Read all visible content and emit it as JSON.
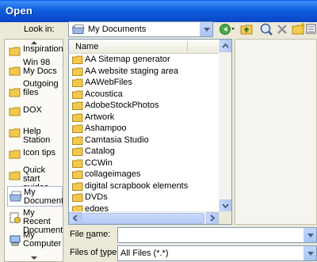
{
  "window": {
    "title": "Open"
  },
  "lookin": {
    "label": "Look in:",
    "value": "My Documents"
  },
  "places": [
    {
      "label": "Inspirations",
      "icon": "folder-icon"
    },
    {
      "label": "Win 98 My Docs",
      "icon": "folder-icon"
    },
    {
      "label": "Outgoing files",
      "icon": "folder-icon"
    },
    {
      "label": "DOX",
      "icon": "folder-icon"
    },
    {
      "label": "Help Station",
      "icon": "folder-icon"
    },
    {
      "label": "Icon tips",
      "icon": "folder-icon"
    },
    {
      "label": "Quick start guides",
      "icon": "folder-icon"
    },
    {
      "label": "My Documents",
      "icon": "my-documents-icon"
    },
    {
      "label": "My Recent Documents",
      "icon": "recent-documents-icon"
    },
    {
      "label": "My Computer",
      "icon": "my-computer-icon"
    }
  ],
  "filelist": {
    "column_name": "Name",
    "items": [
      "AA Sitemap generator",
      "AA website staging area",
      "AAWebFiles",
      "Acoustica",
      "AdobeStockPhotos",
      "Artwork",
      "Ashampoo",
      "Camtasia Studio",
      "Catalog",
      "CCWin",
      "collageimages",
      "digital scrapbook elements",
      "DVDs",
      "edges"
    ]
  },
  "filename": {
    "label_prefix": "File ",
    "label_underlined": "n",
    "label_suffix": "ame:",
    "value": ""
  },
  "filetype": {
    "label_prefix": "Files of ",
    "label_underlined": "t",
    "label_suffix": "ype:",
    "value": "All Files (*.*)"
  },
  "colors": {
    "titlebar": "#0a5de8",
    "dialog_bg": "#ece9d8",
    "folder": "#f2c94c"
  }
}
